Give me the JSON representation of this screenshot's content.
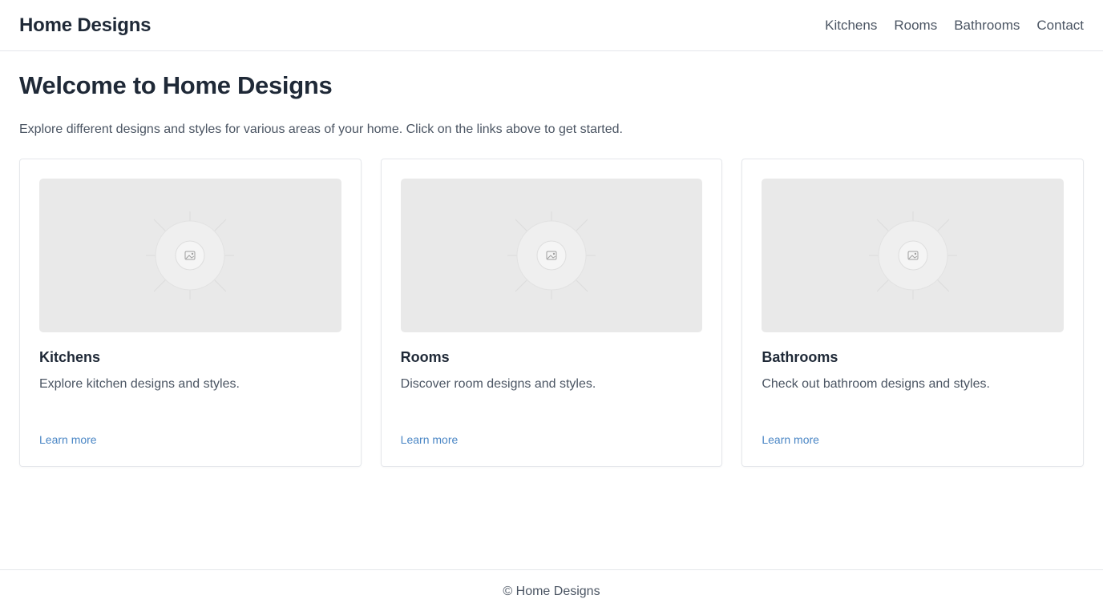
{
  "header": {
    "brand": "Home Designs",
    "nav": [
      "Kitchens",
      "Rooms",
      "Bathrooms",
      "Contact"
    ]
  },
  "main": {
    "title": "Welcome to Home Designs",
    "intro": "Explore different designs and styles for various areas of your home. Click on the links above to get started.",
    "cards": [
      {
        "title": "Kitchens",
        "description": "Explore kitchen designs and styles.",
        "link": "Learn more",
        "image_icon": "image-placeholder-icon"
      },
      {
        "title": "Rooms",
        "description": "Discover room designs and styles.",
        "link": "Learn more",
        "image_icon": "image-placeholder-icon"
      },
      {
        "title": "Bathrooms",
        "description": "Check out bathroom designs and styles.",
        "link": "Learn more",
        "image_icon": "image-placeholder-icon"
      }
    ]
  },
  "footer": {
    "text": "© Home Designs"
  },
  "colors": {
    "link": "#4a86c5",
    "text": "#1f2937",
    "muted": "#4b5563",
    "placeholder": "#e9e9e9"
  }
}
